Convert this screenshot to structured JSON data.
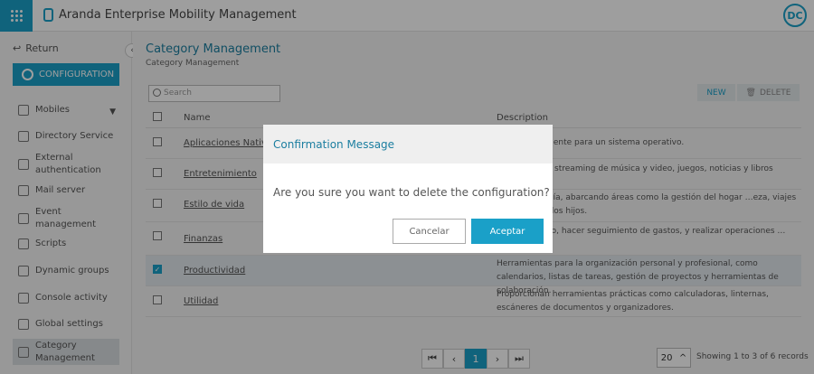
{
  "app": {
    "title": "Aranda Enterprise Mobility Management",
    "user_initials": "DC"
  },
  "sidebar": {
    "return_label": "Return",
    "config_label": "CONFIGURATION",
    "items": [
      {
        "label": "Mobiles",
        "icon": "mobile-icon"
      },
      {
        "label": "Directory Service",
        "icon": "directory-icon"
      },
      {
        "label": "External authentication",
        "icon": "fingerprint-icon"
      },
      {
        "label": "Mail server",
        "icon": "mail-icon"
      },
      {
        "label": "Event management",
        "icon": "event-icon"
      },
      {
        "label": "Scripts",
        "icon": "script-icon"
      },
      {
        "label": "Dynamic groups",
        "icon": "groups-icon"
      },
      {
        "label": "Console activity",
        "icon": "activity-icon"
      },
      {
        "label": "Global settings",
        "icon": "settings-icon"
      },
      {
        "label": "Category Management",
        "icon": "category-icon"
      }
    ]
  },
  "main": {
    "title": "Category Management",
    "breadcrumb": "Category Management",
    "search_placeholder": "Search",
    "new_label": "NEW",
    "delete_label": "DELETE",
    "columns": {
      "name": "Name",
      "description": "Description"
    },
    "rows": [
      {
        "name": "Aplicaciones Nativas",
        "description": "…especificamente para un sistema operativo.",
        "checked": false
      },
      {
        "name": "Entretenimiento",
        "description": "…ciones para streaming de música y video, juegos, noticias y libros",
        "checked": false
      },
      {
        "name": "Estilo de vida",
        "description": "…ar el día a día, abarcando áreas como la gestión del hogar …eza, viajes y cuidado de los hijos.",
        "checked": false
      },
      {
        "name": "Finanzas",
        "description": "…nar el dinero, hacer seguimiento de gastos, y realizar operaciones …ositivas.",
        "checked": false
      },
      {
        "name": "Productividad",
        "description": "Herramientas para la organización personal y profesional, como calendarios, listas de tareas, gestión de proyectos y herramientas de colaboración.",
        "checked": true
      },
      {
        "name": "Utilidad",
        "description": "Proporcionan herramientas prácticas como calculadoras, linternas, escáneres de documentos y organizadores.",
        "checked": false
      }
    ],
    "pagination": {
      "current": "1",
      "page_size": "20",
      "records": "Showing 1 to 3 of 6 records"
    }
  },
  "modal": {
    "title": "Confirmation Message",
    "message": "Are you sure you want to delete the configuration?",
    "cancel_label": "Cancelar",
    "accept_label": "Aceptar"
  },
  "colors": {
    "accent": "#1aa0c8",
    "title": "#1b7ea0"
  }
}
